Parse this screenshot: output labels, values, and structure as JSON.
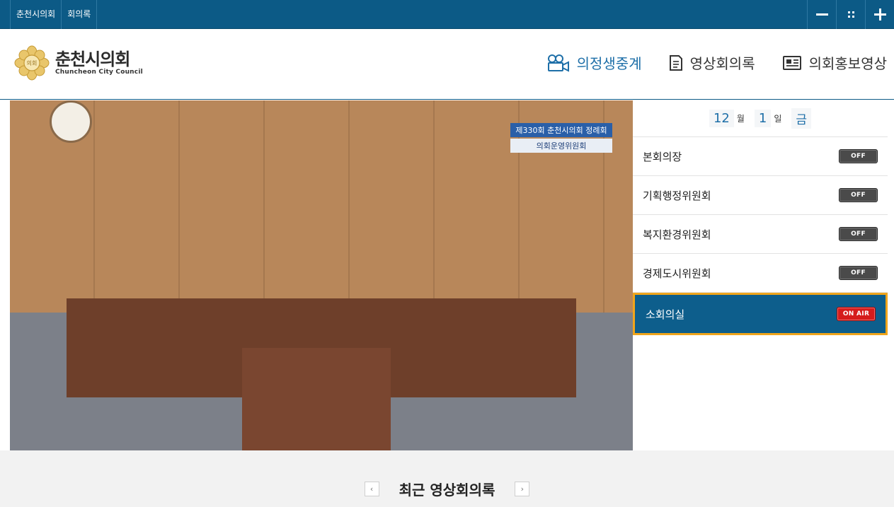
{
  "topbar": {
    "links": [
      "춘천시의회",
      "회의록"
    ],
    "controls": [
      "minus-icon",
      "grid-icon",
      "plus-icon"
    ]
  },
  "header": {
    "logo_ko": "춘천시의회",
    "logo_en": "Chuncheon City Council",
    "logo_seal_text": "의회",
    "nav": [
      {
        "label": "의정생중계",
        "icon": "live-camera-icon",
        "active": true
      },
      {
        "label": "영상회의록",
        "icon": "document-icon",
        "active": false
      },
      {
        "label": "의회홍보영상",
        "icon": "newspaper-icon",
        "active": false
      }
    ]
  },
  "video": {
    "caption_line1": "제330회 춘천시의회 정례회",
    "caption_line2": "의회운영위원회"
  },
  "schedule": {
    "month": "12",
    "month_unit": "월",
    "day": "1",
    "day_unit": "일",
    "weekday": "금",
    "rooms": [
      {
        "name": "본회의장",
        "status": "OFF"
      },
      {
        "name": "기획행정위원회",
        "status": "OFF"
      },
      {
        "name": "복지환경위원회",
        "status": "OFF"
      },
      {
        "name": "경제도시위원회",
        "status": "OFF"
      },
      {
        "name": "소회의실",
        "status": "ON AIR"
      }
    ]
  },
  "recent": {
    "title": "최근 영상회의록",
    "prev": "‹",
    "next": "›"
  },
  "colors": {
    "brand": "#0c5a86",
    "accent": "#1e6fa8",
    "active_border": "#f0a51b",
    "on_air": "#d51c1c"
  }
}
